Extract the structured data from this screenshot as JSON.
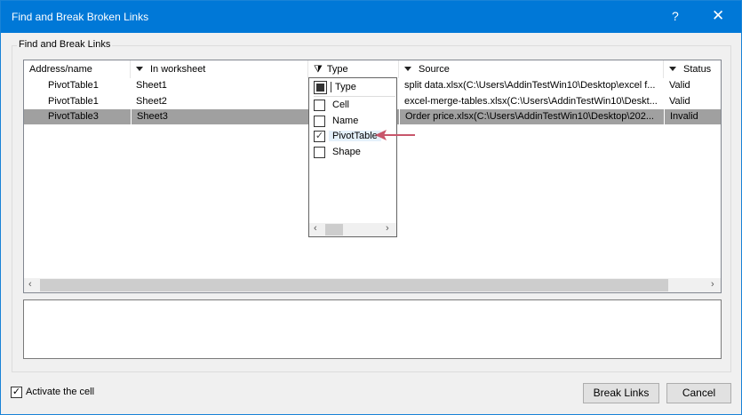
{
  "window": {
    "title": "Find and Break Broken Links",
    "help": "?",
    "close": "✕",
    "accent": "#0078d7"
  },
  "group": {
    "label": "Find and Break Links"
  },
  "table": {
    "columns": [
      "Address/name",
      "In worksheet",
      "Type",
      "Source",
      "Status"
    ],
    "rows": [
      {
        "address": "PivotTable1",
        "worksheet": "Sheet1",
        "source": "split data.xlsx(C:\\Users\\AddinTestWin10\\Desktop\\excel f...",
        "status": "Valid",
        "selected": false
      },
      {
        "address": "PivotTable1",
        "worksheet": "Sheet2",
        "source": "excel-merge-tables.xlsx(C:\\Users\\AddinTestWin10\\Deskt...",
        "status": "Valid",
        "selected": false
      },
      {
        "address": "PivotTable3",
        "worksheet": "Sheet3",
        "source": "Order price.xlsx(C:\\Users\\AddinTestWin10\\Desktop\\202...",
        "status": "Invalid",
        "selected": true
      }
    ]
  },
  "filter_popup": {
    "header": "Type",
    "items": [
      {
        "label": "Cell",
        "checked": false
      },
      {
        "label": "Name",
        "checked": false
      },
      {
        "label": "PivotTable",
        "checked": true
      },
      {
        "label": "Shape",
        "checked": false
      }
    ]
  },
  "footer": {
    "activate_label": "Activate the cell",
    "activate_checked": true,
    "break_links": "Break Links",
    "cancel": "Cancel"
  }
}
